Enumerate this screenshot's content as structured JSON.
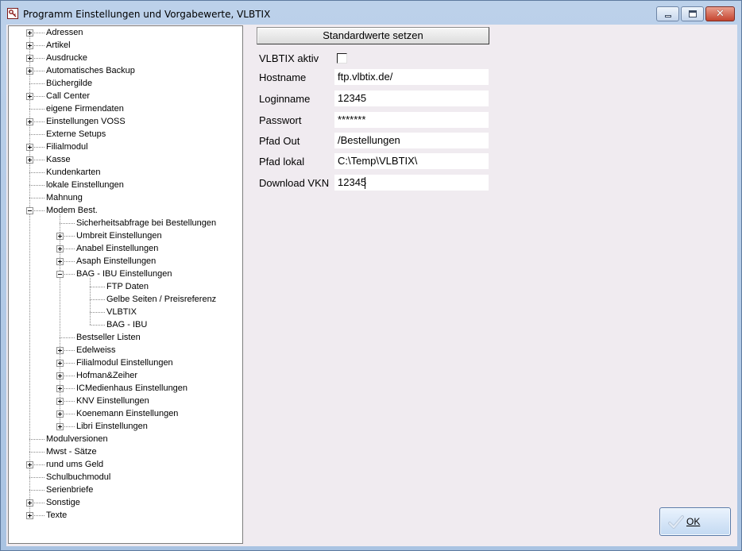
{
  "window": {
    "title": "Programm Einstellungen und Vorgabewerte, VLBTIX",
    "minimize_icon": "minimize-icon",
    "maximize_icon": "maximize-icon",
    "close_glyph": "✕"
  },
  "tree": {
    "items": [
      {
        "label": "Adressen",
        "level": 0,
        "expander": "plus"
      },
      {
        "label": "Artikel",
        "level": 0,
        "expander": "plus"
      },
      {
        "label": "Ausdrucke",
        "level": 0,
        "expander": "plus"
      },
      {
        "label": "Automatisches Backup",
        "level": 0,
        "expander": "plus"
      },
      {
        "label": "Büchergilde",
        "level": 0,
        "expander": "none"
      },
      {
        "label": "Call Center",
        "level": 0,
        "expander": "plus"
      },
      {
        "label": "eigene Firmendaten",
        "level": 0,
        "expander": "none"
      },
      {
        "label": "Einstellungen VOSS",
        "level": 0,
        "expander": "plus"
      },
      {
        "label": "Externe Setups",
        "level": 0,
        "expander": "none"
      },
      {
        "label": "Filialmodul",
        "level": 0,
        "expander": "plus"
      },
      {
        "label": "Kasse",
        "level": 0,
        "expander": "plus"
      },
      {
        "label": "Kundenkarten",
        "level": 0,
        "expander": "none"
      },
      {
        "label": "lokale Einstellungen",
        "level": 0,
        "expander": "none"
      },
      {
        "label": "Mahnung",
        "level": 0,
        "expander": "none"
      },
      {
        "label": "Modem Best.",
        "level": 0,
        "expander": "minus"
      },
      {
        "label": "Sicherheitsabfrage bei Bestellungen",
        "level": 1,
        "expander": "none"
      },
      {
        "label": "Umbreit Einstellungen",
        "level": 1,
        "expander": "plus"
      },
      {
        "label": "Anabel Einstellungen",
        "level": 1,
        "expander": "plus"
      },
      {
        "label": "Asaph Einstellungen",
        "level": 1,
        "expander": "plus"
      },
      {
        "label": "BAG - IBU Einstellungen",
        "level": 1,
        "expander": "minus"
      },
      {
        "label": "FTP Daten",
        "level": 2,
        "expander": "none"
      },
      {
        "label": "Gelbe Seiten / Preisreferenz",
        "level": 2,
        "expander": "none"
      },
      {
        "label": "VLBTIX",
        "level": 2,
        "expander": "none"
      },
      {
        "label": "BAG - IBU",
        "level": 2,
        "expander": "none"
      },
      {
        "label": "Bestseller Listen",
        "level": 1,
        "expander": "none"
      },
      {
        "label": "Edelweiss",
        "level": 1,
        "expander": "plus"
      },
      {
        "label": "Filialmodul Einstellungen",
        "level": 1,
        "expander": "plus"
      },
      {
        "label": "Hofman&Zeiher",
        "level": 1,
        "expander": "plus"
      },
      {
        "label": "ICMedienhaus Einstellungen",
        "level": 1,
        "expander": "plus"
      },
      {
        "label": "KNV Einstellungen",
        "level": 1,
        "expander": "plus"
      },
      {
        "label": "Koenemann Einstellungen",
        "level": 1,
        "expander": "plus"
      },
      {
        "label": "Libri Einstellungen",
        "level": 1,
        "expander": "plus"
      },
      {
        "label": "Modulversionen",
        "level": 0,
        "expander": "none"
      },
      {
        "label": "Mwst - Sätze",
        "level": 0,
        "expander": "none"
      },
      {
        "label": "rund ums Geld",
        "level": 0,
        "expander": "plus"
      },
      {
        "label": "Schulbuchmodul",
        "level": 0,
        "expander": "none"
      },
      {
        "label": "Serienbriefe",
        "level": 0,
        "expander": "none"
      },
      {
        "label": "Sonstige",
        "level": 0,
        "expander": "plus"
      },
      {
        "label": "Texte",
        "level": 0,
        "expander": "plus"
      }
    ]
  },
  "form": {
    "defaults_button": "Standardwerte setzen",
    "vlbtix_active_label": "VLBTIX aktiv",
    "vlbtix_active_checked": false,
    "hostname_label": "Hostname",
    "hostname_value": "ftp.vlbtix.de/",
    "loginname_label": "Loginname",
    "loginname_value": "12345",
    "password_label": "Passwort",
    "password_value": "*******",
    "path_out_label": "Pfad Out",
    "path_out_value": "/Bestellungen",
    "path_local_label": "Pfad lokal",
    "path_local_value": "C:\\Temp\\VLBTIX\\",
    "download_vkn_label": "Download VKN",
    "download_vkn_value": "12345"
  },
  "footer": {
    "ok_label": "OK",
    "ok_icon": "checkmark-icon"
  }
}
